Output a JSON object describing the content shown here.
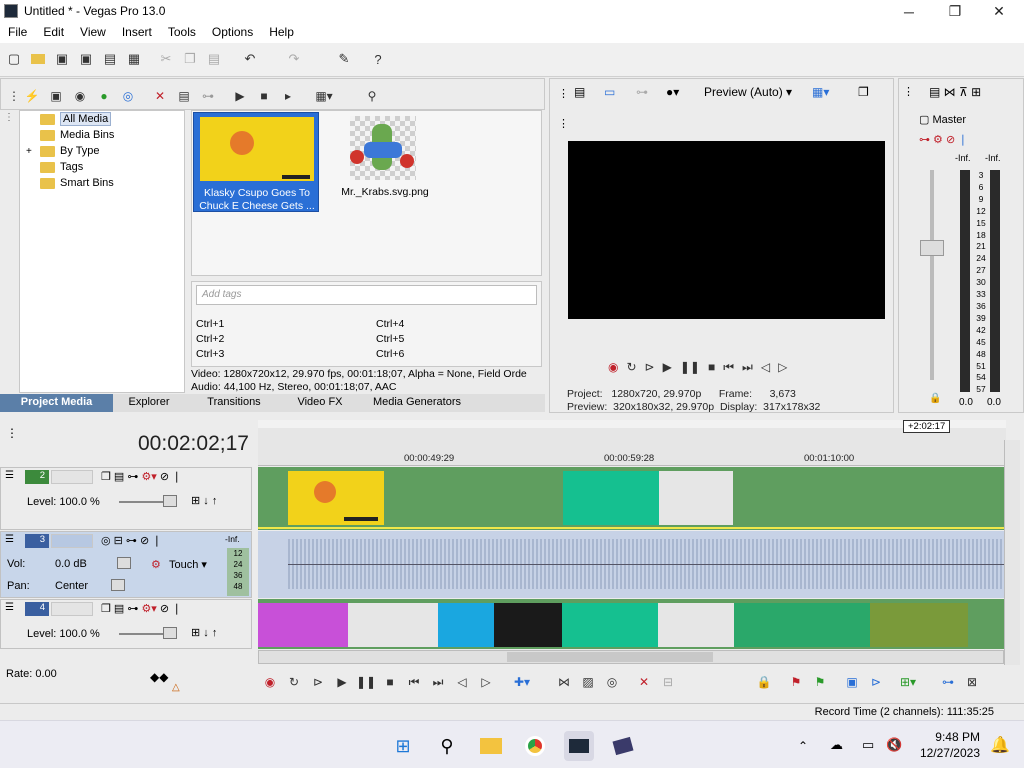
{
  "window": {
    "title": "Untitled * - Vegas Pro 13.0",
    "controls": [
      "─",
      "❐",
      "✕"
    ]
  },
  "menu": [
    "File",
    "Edit",
    "View",
    "Insert",
    "Tools",
    "Options",
    "Help"
  ],
  "toolbar_icons": [
    "new-icon",
    "open-icon",
    "save-icon",
    "save-as-icon",
    "render-icon",
    "properties-icon",
    "cut-icon",
    "copy-icon",
    "paste-icon",
    "undo-icon",
    "redo-icon",
    "event-tool-icon",
    "help-icon"
  ],
  "project_media": {
    "tree": [
      "All Media",
      "Media Bins",
      "By Type",
      "Tags",
      "Smart Bins"
    ],
    "expand_glyph": "+",
    "clips": [
      {
        "name": "Klasky Csupo Goes To Chuck E Cheese Gets ..."
      },
      {
        "name": "Mr._Krabs.svg.png"
      }
    ],
    "tag_placeholder": "Add tags",
    "shortcuts": [
      "Ctrl+1",
      "Ctrl+4",
      "Ctrl+2",
      "Ctrl+5",
      "Ctrl+3",
      "Ctrl+6"
    ],
    "info_video": "Video: 1280x720x12, 29.970 fps, 00:01:18;07, Alpha = None, Field Orde",
    "info_audio": "Audio: 44,100 Hz, Stereo, 00:01:18;07, AAC",
    "tabs": [
      "Project Media",
      "Explorer",
      "Transitions",
      "Video FX",
      "Media Generators"
    ]
  },
  "preview": {
    "mode": "Preview (Auto)",
    "project_label": "Project:",
    "project_value": "1280x720, 29.970p",
    "frame_label": "Frame:",
    "frame_value": "3,673",
    "preview_label": "Preview:",
    "preview_value": "320x180x32, 29.970p",
    "display_label": "Display:",
    "display_value": "317x178x32"
  },
  "master": {
    "title": "Master",
    "left_inf": "-Inf.",
    "right_inf": "-Inf.",
    "scale": [
      "3",
      "6",
      "9",
      "12",
      "15",
      "18",
      "21",
      "24",
      "27",
      "30",
      "33",
      "36",
      "39",
      "42",
      "45",
      "48",
      "51",
      "54",
      "57"
    ],
    "left_val": "0.0",
    "right_val": "0.0"
  },
  "timeline": {
    "timecode": "00:02:02;17",
    "marker": "+2:02:17",
    "ruler": [
      "00:00:49:29",
      "00:00:59:28",
      "00:01:10:00"
    ],
    "tracks": [
      {
        "number": "2",
        "label": "Level:",
        "value": "100.0 %"
      },
      {
        "number": "3",
        "vol_label": "Vol:",
        "vol_value": "0.0 dB",
        "pan_label": "Pan:",
        "pan_value": "Center",
        "mode": "Touch",
        "inf": "-Inf.",
        "meter": [
          "12",
          "24",
          "36",
          "48"
        ]
      },
      {
        "number": "4",
        "label": "Level:",
        "value": "100.0 %"
      }
    ],
    "rate_label": "Rate:",
    "rate_value": "0.00"
  },
  "status": {
    "record_time": "Record Time (2 channels): 111:35:25"
  },
  "taskbar": {
    "apps": [
      "start-icon",
      "search-icon",
      "file-explorer-icon",
      "chrome-icon",
      "vegas-icon",
      "vegas-alt-icon"
    ],
    "time": "9:48 PM",
    "date": "12/27/2023"
  },
  "colors": {
    "video_track": "#5f9e5f",
    "audio_track": "#c7d2e6",
    "active_tab": "#5b7fa8",
    "selection": "#2a6fd6"
  }
}
